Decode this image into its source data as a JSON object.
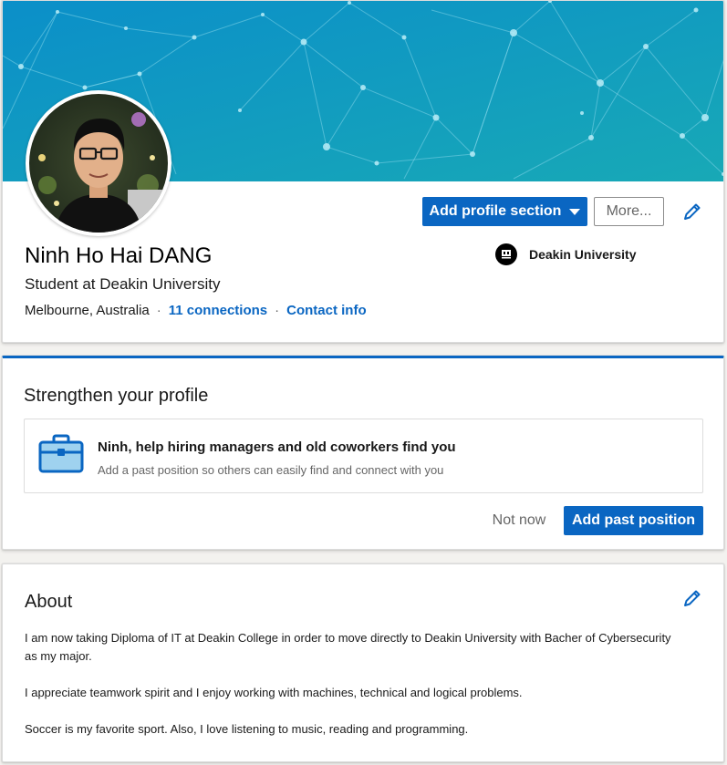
{
  "colors": {
    "accent": "#0a66c2",
    "banner_top": "#0b8fc9",
    "banner_bottom": "#16a8b9",
    "page_bg": "#f3f2ef"
  },
  "profile": {
    "name": "Ninh Ho Hai DANG",
    "headline": "Student at Deakin University",
    "location": "Melbourne, Australia",
    "connections": "11 connections",
    "contact_info": "Contact info",
    "separator": "·",
    "education": "Deakin University",
    "avatar_icon": "profile-photo",
    "edit_icon": "pencil-icon"
  },
  "actions": {
    "add_profile_section": "Add profile section",
    "more": "More..."
  },
  "strengthen": {
    "title": "Strengthen your profile",
    "suggestion_title": "Ninh, help hiring managers and old coworkers find you",
    "suggestion_subtitle": "Add a past position so others can easily find and connect with you",
    "icon": "briefcase-icon",
    "not_now": "Not now",
    "add_past_position": "Add past position"
  },
  "about": {
    "title": "About",
    "paragraphs": [
      "I am now taking Diploma of IT at Deakin College in order to move directly to Deakin University with Bacher of Cybersecurity as my major.",
      "I appreciate teamwork spirit and I enjoy working with machines, technical and logical problems.",
      "Soccer is my favorite sport. Also, I love listening to music, reading and programming."
    ]
  }
}
